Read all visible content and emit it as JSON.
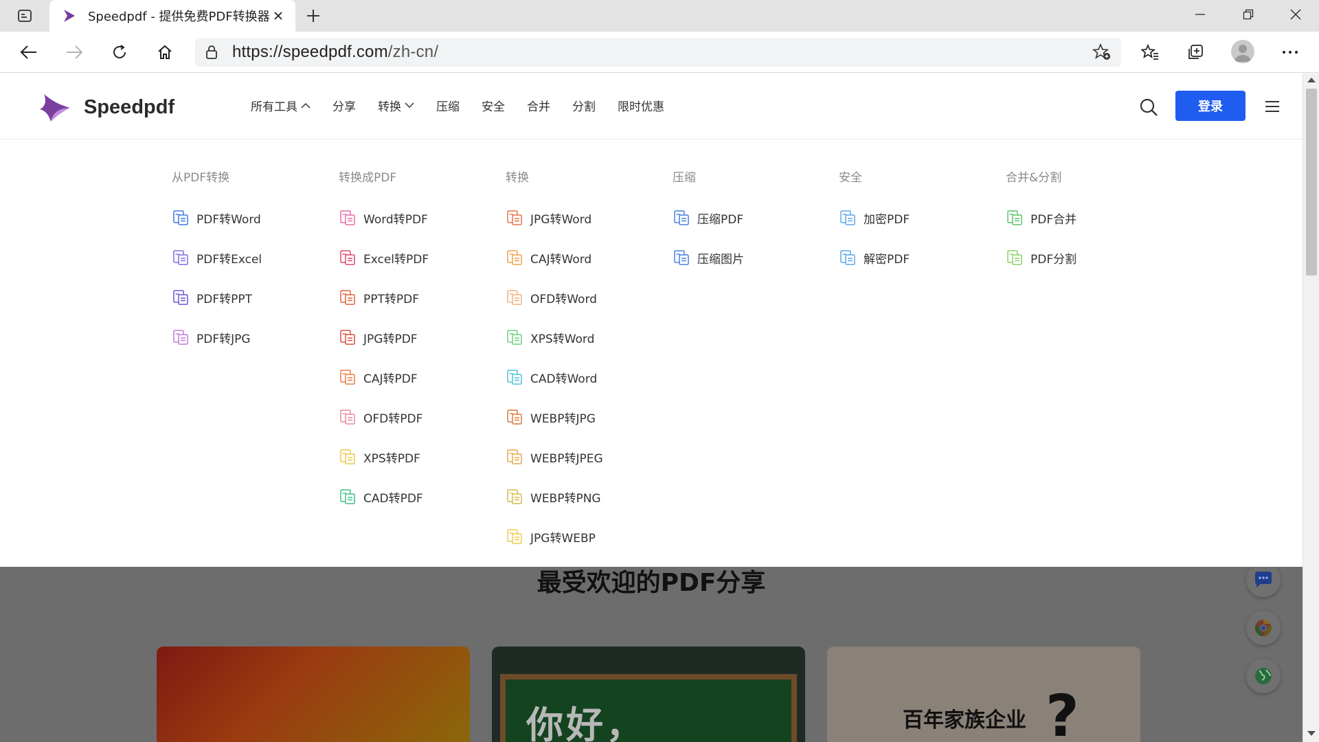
{
  "browser": {
    "tab_title": "Speedpdf - 提供免费PDF转换器、",
    "url_host": "https://speedpdf.com",
    "url_path": "/zh-cn/"
  },
  "site": {
    "brand": "Speedpdf",
    "nav": [
      {
        "label": "所有工具",
        "has_caret": "up"
      },
      {
        "label": "分享"
      },
      {
        "label": "转换",
        "has_caret": "down"
      },
      {
        "label": "压缩"
      },
      {
        "label": "安全"
      },
      {
        "label": "合并"
      },
      {
        "label": "分割"
      },
      {
        "label": "限时优惠"
      }
    ],
    "login_label": "登录",
    "brand_color": "#1f5cf0"
  },
  "menu": {
    "columns": [
      {
        "title": "从PDF转换",
        "items": [
          {
            "label": "PDF转Word",
            "icon": "pdf-to-word-icon",
            "color": "#3b7ae0"
          },
          {
            "label": "PDF转Excel",
            "icon": "pdf-to-excel-icon",
            "color": "#7b6ce0"
          },
          {
            "label": "PDF转PPT",
            "icon": "pdf-to-ppt-icon",
            "color": "#6c52d6"
          },
          {
            "label": "PDF转JPG",
            "icon": "pdf-to-jpg-icon",
            "color": "#c07ad8"
          }
        ]
      },
      {
        "title": "转换成PDF",
        "items": [
          {
            "label": "Word转PDF",
            "icon": "word-to-pdf-icon",
            "color": "#e56ba8"
          },
          {
            "label": "Excel转PDF",
            "icon": "excel-to-pdf-icon",
            "color": "#d9486e"
          },
          {
            "label": "PPT转PDF",
            "icon": "ppt-to-pdf-icon",
            "color": "#e2603e"
          },
          {
            "label": "JPG转PDF",
            "icon": "jpg-to-pdf-icon",
            "color": "#d64f3e"
          },
          {
            "label": "CAJ转PDF",
            "icon": "caj-to-pdf-icon",
            "color": "#ec7a3e"
          },
          {
            "label": "OFD转PDF",
            "icon": "ofd-to-pdf-icon",
            "color": "#e88a9a"
          },
          {
            "label": "XPS转PDF",
            "icon": "xps-to-pdf-icon",
            "color": "#e8c94a"
          },
          {
            "label": "CAD转PDF",
            "icon": "cad-to-pdf-icon",
            "color": "#3cbf8a"
          }
        ]
      },
      {
        "title": "转换",
        "items": [
          {
            "label": "JPG转Word",
            "icon": "jpg-to-word-icon",
            "color": "#e8734a"
          },
          {
            "label": "CAJ转Word",
            "icon": "caj-to-word-icon",
            "color": "#f0a04a"
          },
          {
            "label": "OFD转Word",
            "icon": "ofd-to-word-icon",
            "color": "#f2b07a"
          },
          {
            "label": "XPS转Word",
            "icon": "xps-to-word-icon",
            "color": "#6ad07a"
          },
          {
            "label": "CAD转Word",
            "icon": "cad-to-word-icon",
            "color": "#4ec3d6"
          },
          {
            "label": "WEBP转JPG",
            "icon": "webp-to-jpg-icon",
            "color": "#d87a3a"
          },
          {
            "label": "WEBP转JPEG",
            "icon": "webp-to-jpeg-icon",
            "color": "#e8a64a"
          },
          {
            "label": "WEBP转PNG",
            "icon": "webp-to-png-icon",
            "color": "#d8b84a"
          },
          {
            "label": "JPG转WEBP",
            "icon": "jpg-to-webp-icon",
            "color": "#f0c84a"
          }
        ]
      },
      {
        "title": "压缩",
        "items": [
          {
            "label": "压缩PDF",
            "icon": "compress-pdf-icon",
            "color": "#4a7ee0"
          },
          {
            "label": "压缩图片",
            "icon": "compress-image-icon",
            "color": "#4a7ee0"
          }
        ]
      },
      {
        "title": "安全",
        "items": [
          {
            "label": "加密PDF",
            "icon": "encrypt-pdf-icon",
            "color": "#5aa6e8"
          },
          {
            "label": "解密PDF",
            "icon": "decrypt-pdf-icon",
            "color": "#5aa6e8"
          }
        ]
      },
      {
        "title": "合并&分割",
        "items": [
          {
            "label": "PDF合并",
            "icon": "merge-pdf-icon",
            "color": "#5cc46a"
          },
          {
            "label": "PDF分割",
            "icon": "split-pdf-icon",
            "color": "#8ad06a"
          }
        ]
      }
    ]
  },
  "behind": {
    "section_heading": "最受欢迎的PDF分享",
    "card2_text": "你好，",
    "card3_text": "百年家族企业",
    "card3_mark": "?"
  }
}
